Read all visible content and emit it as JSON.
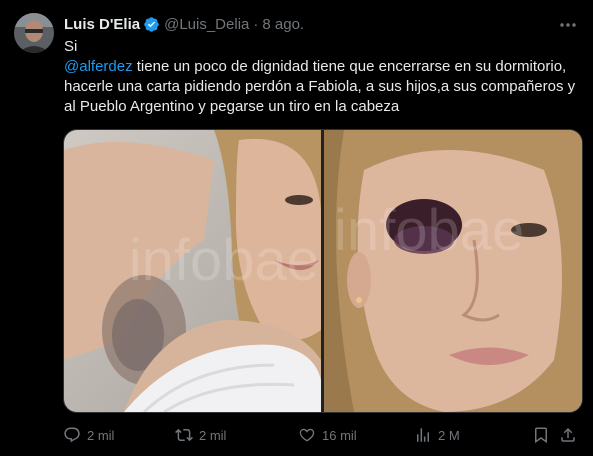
{
  "tweet": {
    "author_name": "Luis D'Elia",
    "handle": "@Luis_Delia",
    "separator": "·",
    "date": "8 ago.",
    "line1": "Si",
    "mention": "@alferdez",
    "body": " tiene un poco de dignidad tiene que encerrarse en su dormitorio, hacerle una carta pidiendo perdón a Fabiola, a sus hijos,a sus compañeros y al Pueblo Argentino y pegarse un tiro en la cabeza"
  },
  "media": {
    "watermark": "infobae"
  },
  "actions": {
    "replies": "2 mil",
    "reposts": "2 mil",
    "likes": "16 mil",
    "views": "2 M"
  },
  "colors": {
    "background": "#000000",
    "text": "#e7e9ea",
    "secondary": "#71767b",
    "link": "#1d9bf0",
    "verified": "#1d9bf0"
  },
  "icons": [
    "verified-badge-icon",
    "more-icon",
    "reply-icon",
    "repost-icon",
    "like-icon",
    "views-icon",
    "bookmark-icon",
    "share-icon"
  ]
}
